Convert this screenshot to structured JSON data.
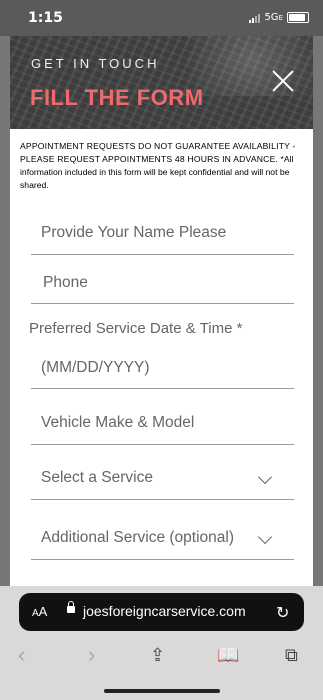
{
  "status": {
    "time": "1:15",
    "network": "5G",
    "network_suffix": "E"
  },
  "hero": {
    "subtitle": "GET IN TOUCH",
    "title": "FILL THE FORM"
  },
  "form": {
    "disclaimer_caps": "APPOINTMENT REQUESTS DO NOT GUARANTEE AVAILABILITY - PLEASE REQUEST APPOINTMENTS 48 HOURS IN ADVANCE.",
    "disclaimer_rest": " *All information included in this form will be kept confidential and will not be shared.",
    "name_placeholder": "Provide Your Name Please",
    "phone_placeholder": "Phone",
    "date_label": "Preferred Service Date & Time *",
    "date_placeholder": "(MM/DD/YYYY)",
    "vehicle_placeholder": "Vehicle Make & Model",
    "service_select": "Select a Service",
    "additional_select": "Additional Service (optional)"
  },
  "browser": {
    "text_size": "AA",
    "url": "joesforeigncarservice.com"
  },
  "icons": {
    "close": "close-icon",
    "reload": "reload-icon",
    "back": "back-icon",
    "forward": "forward-icon",
    "share": "share-icon",
    "bookmarks": "book-icon",
    "tabs": "tabs-icon"
  }
}
